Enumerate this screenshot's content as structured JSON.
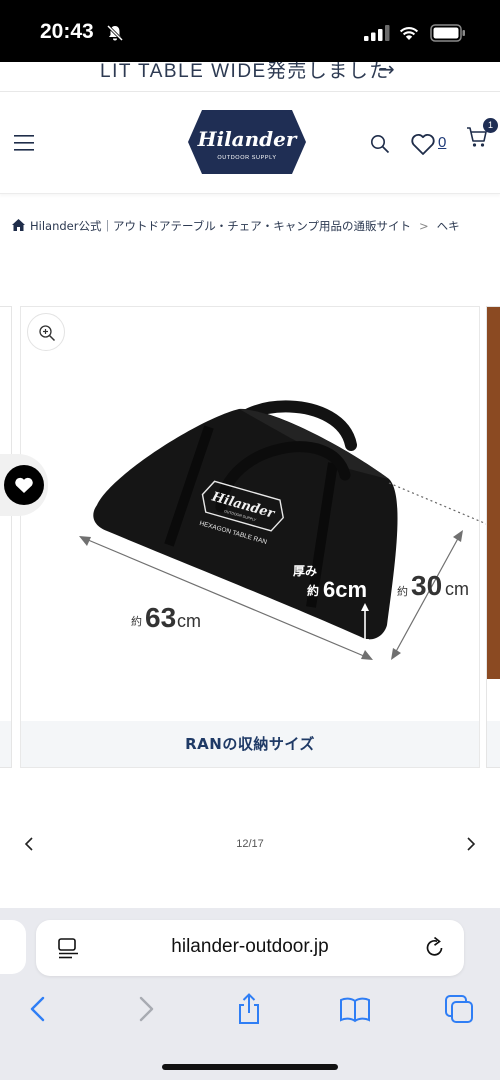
{
  "status": {
    "time": "20:43"
  },
  "announcement": {
    "text": "LIT TABLE WIDE発売しました",
    "arrow": "→"
  },
  "header": {
    "wishlist_count": "0",
    "cart_count": "1",
    "logo_text": "Hilander",
    "logo_subtext": "OUTDOOR SUPPLY"
  },
  "breadcrumb": {
    "home": "Hilander公式｜アウトドアテーブル・チェア・キャンプ用品の通販サイト",
    "separator": ">",
    "current": "ヘキ"
  },
  "gallery": {
    "caption": "RANの収納サイズ",
    "bag_brand": "Hilander",
    "bag_subbrand": "OUTDOOR SUPPLY",
    "bag_label": "HEXAGON TABLE RAN",
    "dim_width_prefix": "約",
    "dim_width_value": "63",
    "dim_width_unit": "cm",
    "dim_depth_label": "厚み",
    "dim_depth_prefix": "約",
    "dim_depth_value": "6cm",
    "dim_height_prefix": "約",
    "dim_height_value": "30",
    "dim_height_unit": "cm",
    "pager": "12/17"
  },
  "safari": {
    "url": "hilander-outdoor.jp"
  },
  "colors": {
    "navy": "#1f2e54",
    "caption_text": "#1f3a66",
    "caption_bg": "#f4f6f8",
    "safari_blue": "#2f7ef5"
  }
}
